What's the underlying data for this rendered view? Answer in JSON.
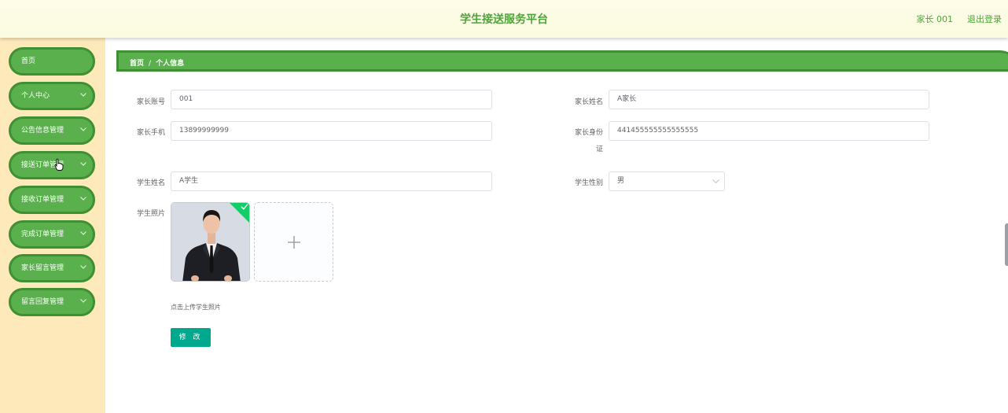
{
  "header": {
    "title": "学生接送服务平台",
    "user": "家长 001",
    "logout": "退出登录"
  },
  "sidebar": {
    "items": [
      {
        "label": "首页",
        "has_arrow": false
      },
      {
        "label": "个人中心",
        "has_arrow": true
      },
      {
        "label": "公告信息管理",
        "has_arrow": true
      },
      {
        "label": "接送订单管理",
        "has_arrow": true
      },
      {
        "label": "接收订单管理",
        "has_arrow": true
      },
      {
        "label": "完成订单管理",
        "has_arrow": true
      },
      {
        "label": "家长留言管理",
        "has_arrow": true
      },
      {
        "label": "留言回复管理",
        "has_arrow": true
      }
    ]
  },
  "breadcrumb": {
    "home": "首页",
    "separator": "/",
    "current": "个人信息"
  },
  "form": {
    "parent_account": {
      "label": "家长账号",
      "value": "001"
    },
    "parent_name": {
      "label": "家长姓名",
      "value": "A家长"
    },
    "parent_phone": {
      "label": "家长手机",
      "value": "13899999999"
    },
    "parent_id_card": {
      "label_line1": "家长身份",
      "label_line2": "证",
      "value": "441455555555555555"
    },
    "student_name": {
      "label": "学生姓名",
      "value": "A学生"
    },
    "student_gender": {
      "label": "学生性别",
      "value": "男"
    },
    "student_photo": {
      "label": "学生照片",
      "hint": "点击上传学生照片"
    },
    "submit_label": "修 改"
  },
  "colors": {
    "header_title": "#4fa43b",
    "menu_bg": "#5ab04d",
    "menu_border": "#3f8f33",
    "sidebar_bg": "#fde9b9",
    "button_bg": "#00a98e",
    "success_badge": "#13ce66"
  }
}
